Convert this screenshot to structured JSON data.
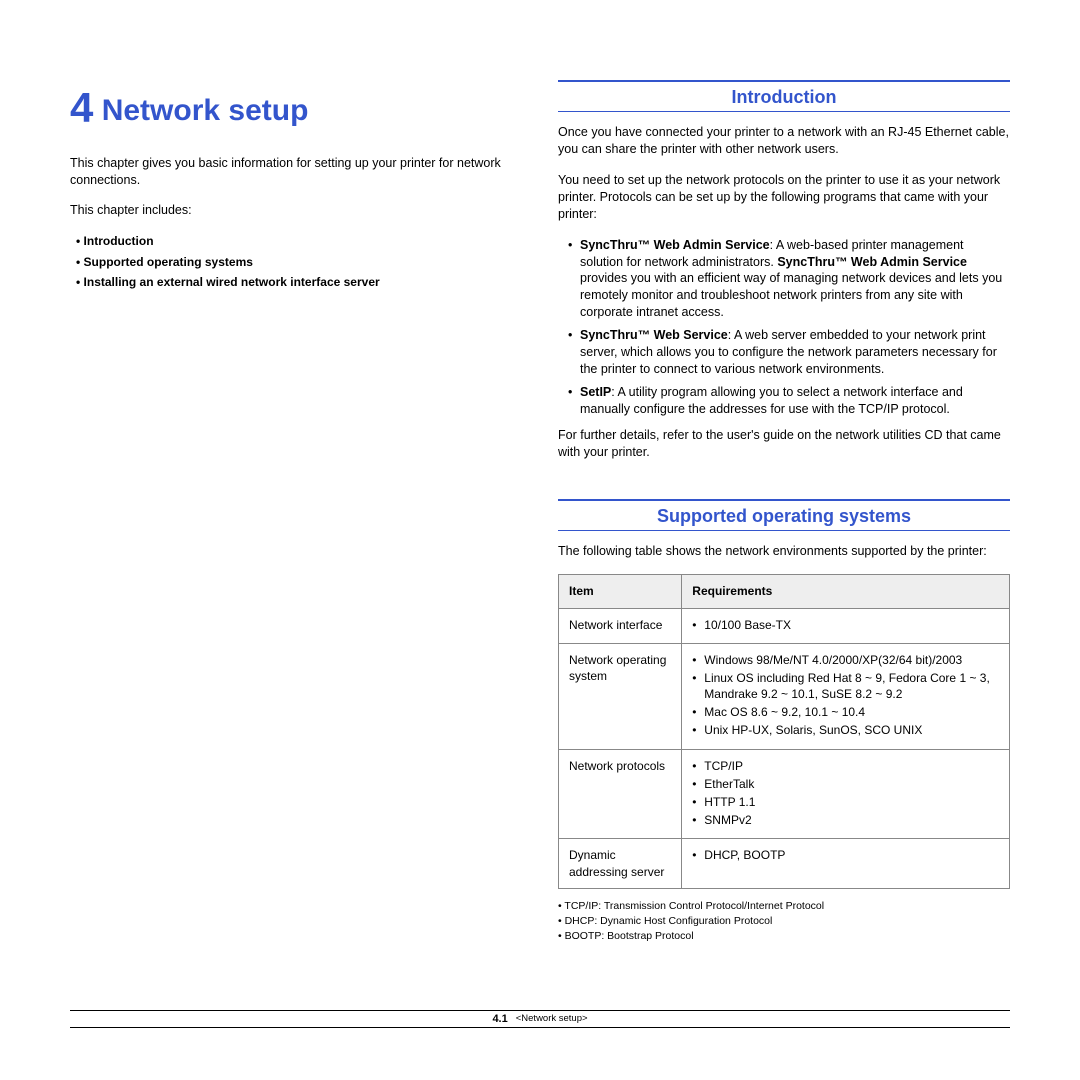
{
  "chapter": {
    "num": "4",
    "title": "Network setup",
    "intro_para": "This chapter gives you basic information for setting up your printer for network connections.",
    "includes_label": "This chapter includes:",
    "toc": [
      "Introduction",
      "Supported operating systems",
      "Installing an external wired network interface server"
    ]
  },
  "introduction": {
    "heading": "Introduction",
    "p1": "Once you have connected your printer to a network with an RJ-45 Ethernet cable, you can share the printer with other network users.",
    "p2": "You need to set up the network protocols on the printer to use it as your network printer. Protocols can be set up by the following programs that came with your printer:",
    "bullets": [
      {
        "bold": "SyncThru™ Web Admin Service",
        "rest_before": ": A web-based printer management solution for network administrators. ",
        "bold2": "SyncThru™ Web Admin Service",
        "rest_after": " provides you with an efficient way of managing network devices and lets you remotely monitor and troubleshoot network printers from any site with corporate intranet access."
      },
      {
        "bold": "SyncThru™ Web Service",
        "rest_before": ": A web server embedded to your network print server, which allows you to configure the network parameters necessary for the printer to connect to various network environments.",
        "bold2": "",
        "rest_after": ""
      },
      {
        "bold": "SetIP",
        "rest_before": ": A utility program allowing you to select a network interface and manually configure the addresses for use with the TCP/IP protocol.",
        "bold2": "",
        "rest_after": ""
      }
    ],
    "p3": "For further details, refer to the user's guide on the network utilities CD that came with your printer."
  },
  "supported": {
    "heading": "Supported operating systems",
    "intro": "The following table shows the network environments supported by the printer:",
    "table": {
      "head": {
        "c1": "Item",
        "c2": "Requirements"
      },
      "rows": [
        {
          "item": "Network interface",
          "req": [
            "10/100 Base-TX"
          ]
        },
        {
          "item": "Network operating system",
          "req": [
            "Windows 98/Me/NT 4.0/2000/XP(32/64 bit)/2003",
            "Linux OS including Red Hat 8 ~ 9, Fedora Core 1 ~ 3, Mandrake 9.2 ~ 10.1, SuSE 8.2 ~ 9.2",
            "Mac OS 8.6 ~ 9.2, 10.1 ~ 10.4",
            "Unix HP-UX, Solaris, SunOS, SCO UNIX"
          ]
        },
        {
          "item": "Network protocols",
          "req": [
            "TCP/IP",
            "EtherTalk",
            "HTTP 1.1",
            "SNMPv2"
          ]
        },
        {
          "item": "Dynamic addressing server",
          "req": [
            "DHCP, BOOTP"
          ]
        }
      ]
    },
    "footnotes": [
      "TCP/IP: Transmission Control Protocol/Internet Protocol",
      "DHCP: Dynamic Host Configuration Protocol",
      "BOOTP: Bootstrap Protocol"
    ]
  },
  "footer": {
    "page": "4.1",
    "chapter_label": "<Network setup>"
  }
}
